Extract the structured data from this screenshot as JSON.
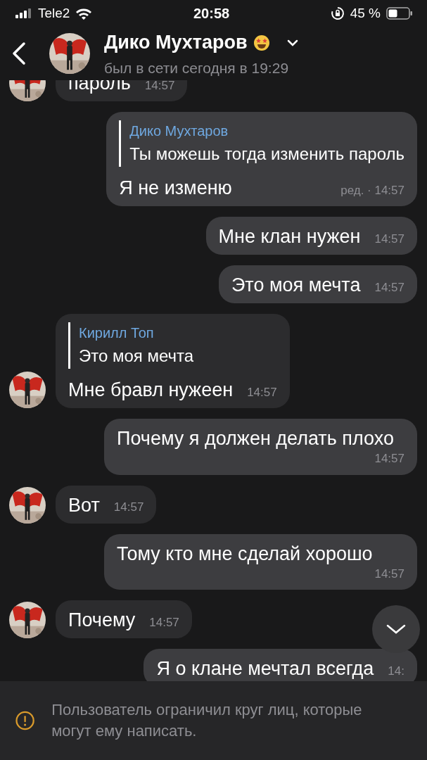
{
  "status_bar": {
    "carrier": "Tele2",
    "time": "20:58",
    "battery": "45 %"
  },
  "header": {
    "name": "Дико Мухтаров",
    "status": "был в сети сегодня в 19:29"
  },
  "messages": [
    {
      "kind": "in",
      "avatar": true,
      "text": "пароль",
      "time": "14:57"
    },
    {
      "kind": "out",
      "reply": {
        "author": "Дико Мухтаров",
        "text": "Ты можешь тогда изменить пароль"
      },
      "text": "Я не изменю",
      "edited": "ред. ·",
      "time": "14:57"
    },
    {
      "kind": "out",
      "text": "Мне клан нужен",
      "time": "14:57"
    },
    {
      "kind": "out",
      "text": "Это моя мечта",
      "time": "14:57"
    },
    {
      "kind": "in",
      "avatar": true,
      "reply": {
        "author": "Кирилл Топ",
        "text": "Это моя мечта"
      },
      "text": "Мне бравл нужеен",
      "time": "14:57"
    },
    {
      "kind": "out",
      "text": "Почему я должен делать плохо",
      "time": "14:57"
    },
    {
      "kind": "in",
      "avatar": true,
      "text": "Вот",
      "time": "14:57"
    },
    {
      "kind": "out",
      "text": "Тому кто мне сделай хорошо",
      "time": "14:57"
    },
    {
      "kind": "in",
      "avatar": true,
      "text": "Почему",
      "time": "14:57"
    },
    {
      "kind": "out",
      "text": "Я о клане мечтал всегда",
      "time": "14:"
    }
  ],
  "notice": "Пользователь ограничил круг лиц, которые могут ему написать."
}
